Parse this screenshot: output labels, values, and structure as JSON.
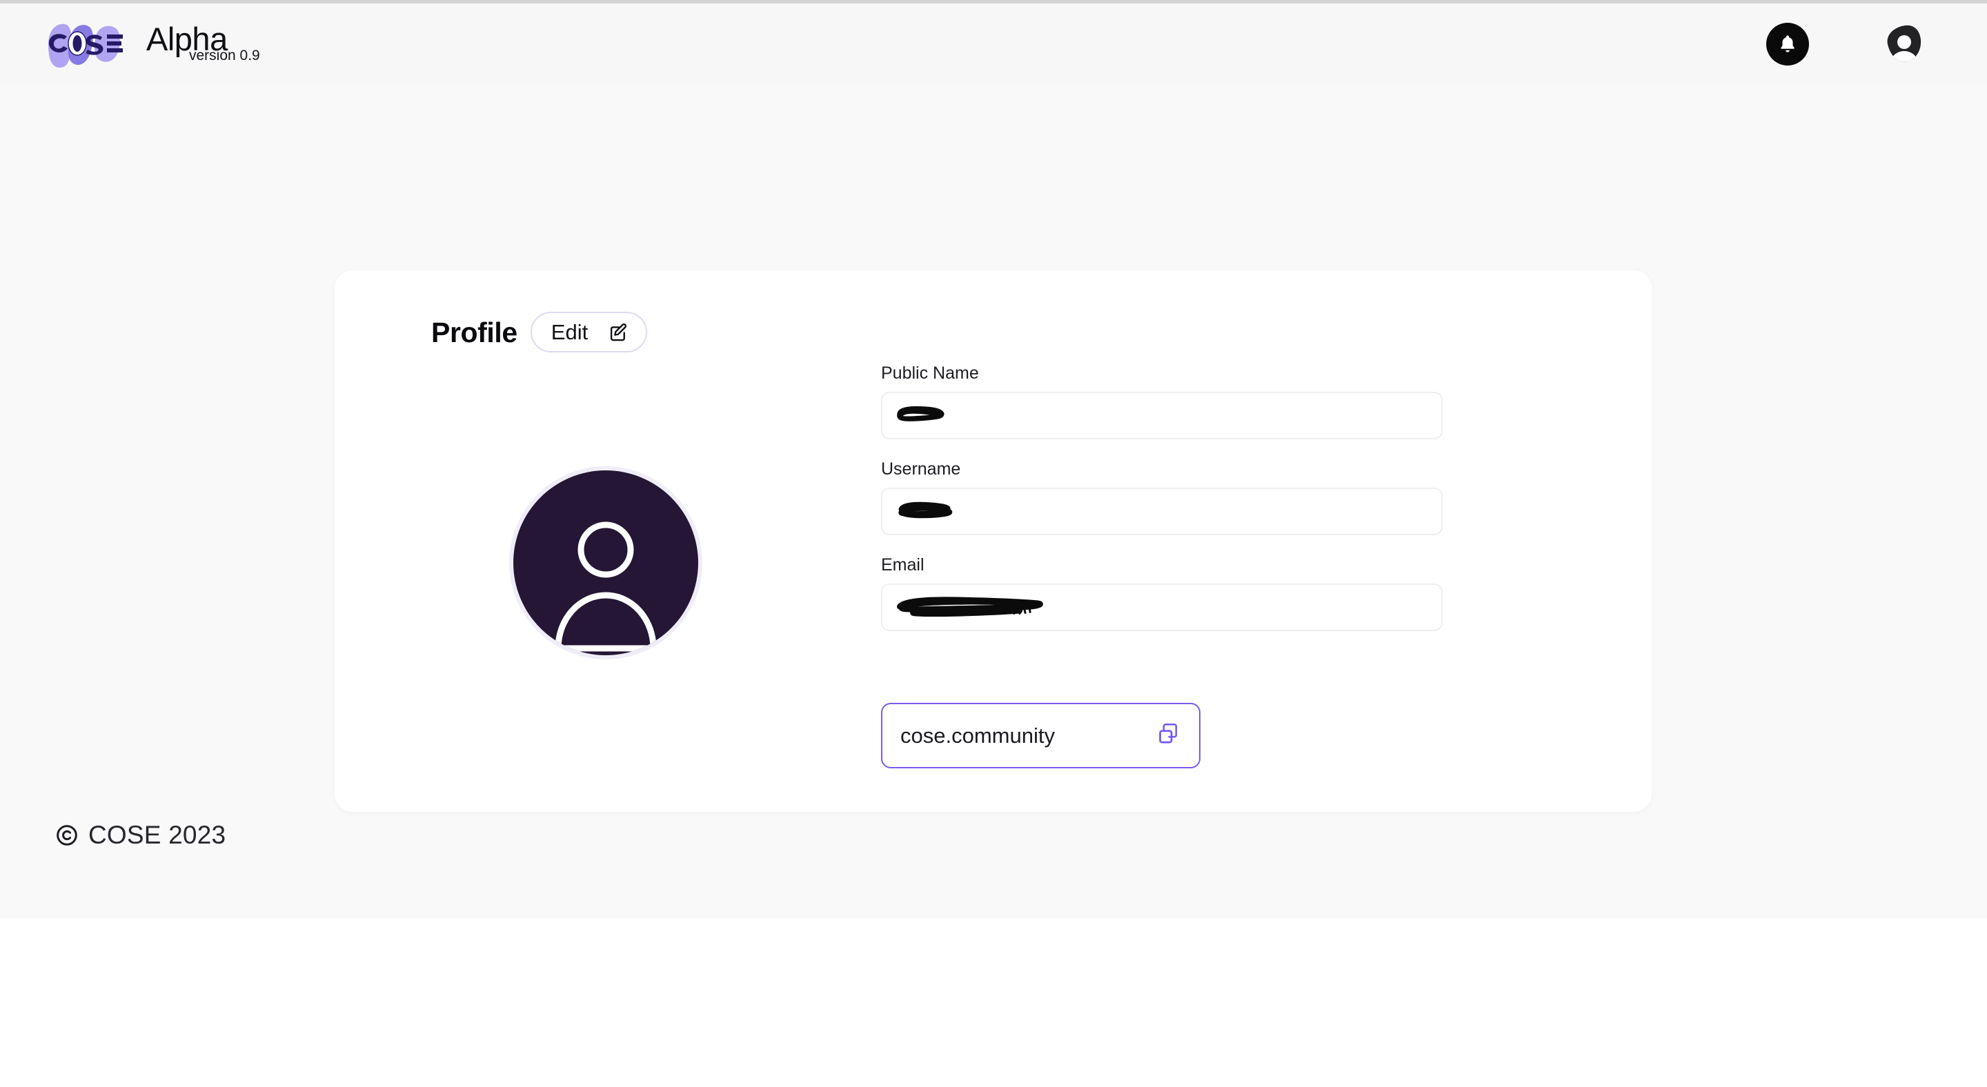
{
  "header": {
    "logo_alt": "COSE",
    "logo_letters": "COSE",
    "brand_name": "Alpha",
    "brand_version": "version 0.9",
    "notification_icon": "bell-icon",
    "avatar_icon": "user-avatar-icon",
    "colors": {
      "logo_blob_light": "#a99bf0",
      "logo_blob_mid": "#7b6ce0",
      "logo_letter": "#241a66",
      "bell_bg": "#0a0a0a",
      "avatar_bg": "#232326"
    }
  },
  "card": {
    "title": "Profile",
    "edit_button": {
      "label": "Edit",
      "icon": "edit-pencil-icon"
    },
    "avatar": {
      "icon": "profile-person-icon",
      "bg_color": "#241634",
      "ring_color": "#ece9f6"
    },
    "fields": [
      {
        "label": "Public Name",
        "value": "",
        "placeholder": "",
        "redacted": true,
        "redaction_width": 62
      },
      {
        "label": "Username",
        "value": "",
        "placeholder": "",
        "redacted": true,
        "redaction_width": 76
      },
      {
        "label": "Email",
        "value": "",
        "placeholder": "",
        "redacted": true,
        "redaction_width": 210
      }
    ],
    "domain_field": {
      "value": "cose.community",
      "icon": "copy-icon",
      "border_color": "#7a5af0",
      "icon_color": "#7a5af0"
    }
  },
  "footer": {
    "copyright_icon": "copyright-icon",
    "text": "COSE 2023"
  }
}
